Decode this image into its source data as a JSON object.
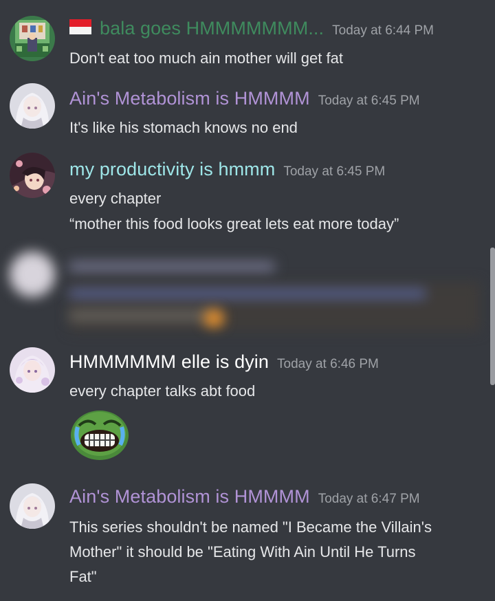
{
  "colors": {
    "background": "#36393f",
    "name_green": "#3f8b5e",
    "name_purple": "#b193d6",
    "name_cyan": "#9ee6e8",
    "name_white": "#ffffff",
    "timestamp": "#9fa2a7",
    "text": "#e6e7e9"
  },
  "messages": [
    {
      "author": "bala goes HMMMMMMM...",
      "timestamp": "Today at 6:44 PM",
      "lines": [
        "Don't eat too much ain mother will get fat"
      ]
    },
    {
      "author": "Ain's Metabolism is HMMMM",
      "timestamp": "Today at 6:45 PM",
      "lines": [
        "It's like his stomach knows no end"
      ]
    },
    {
      "author": "my productivity is hmmm",
      "timestamp": "Today at 6:45 PM",
      "lines": [
        "every chapter",
        "“mother this food looks great lets eat more today”"
      ]
    },
    {
      "author": "HMMMMMM elle is dyin",
      "timestamp": "Today at 6:46 PM",
      "lines": [
        "every chapter talks abt food"
      ],
      "attachment_icon": "crying-laughing-pepe-emoji"
    },
    {
      "author": "Ain's Metabolism is HMMMM",
      "timestamp": "Today at 6:47 PM",
      "lines": [
        "This series shouldn't be named \"I Became the Villain's",
        "Mother\" it should be \"Eating With Ain Until He Turns",
        "Fat\""
      ]
    }
  ],
  "icons": {
    "flag": "indonesia-flag-icon",
    "blurred_message": "redacted-blurred-message"
  }
}
